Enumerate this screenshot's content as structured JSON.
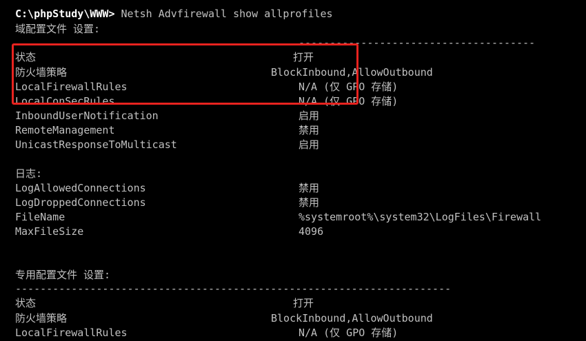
{
  "terminal": {
    "prompt": "C:\\phpStudy\\WWW>",
    "command": " Netsh Advfirewall show allprofiles",
    "domain_header": "域配置文件 设置:",
    "separator": "----------------------------------------------------------------------",
    "domain_rows": [
      {
        "key": "状态",
        "value": "打开"
      },
      {
        "key": "防火墙策略",
        "value": "BlockInbound,AllowOutbound"
      },
      {
        "key": "LocalFirewallRules",
        "value": "N/A (仅 GPO 存储)"
      },
      {
        "key": "LocalConSecRules",
        "value": "N/A (仅 GPO 存储)"
      },
      {
        "key": "InboundUserNotification",
        "value": "启用"
      },
      {
        "key": "RemoteManagement",
        "value": "禁用"
      },
      {
        "key": "UnicastResponseToMulticast",
        "value": "启用"
      }
    ],
    "log_header": "日志:",
    "log_rows": [
      {
        "key": "LogAllowedConnections",
        "value": "禁用"
      },
      {
        "key": "LogDroppedConnections",
        "value": "禁用"
      },
      {
        "key": "FileName",
        "value": "%systemroot%\\system32\\LogFiles\\Firewall"
      },
      {
        "key": "MaxFileSize",
        "value": "4096"
      }
    ],
    "private_header": "专用配置文件 设置:",
    "private_rows": [
      {
        "key": "状态",
        "value": "打开"
      },
      {
        "key": "防火墙策略",
        "value": "BlockInbound,AllowOutbound"
      },
      {
        "key": "LocalFirewallRules",
        "value": "N/A (仅 GPO 存储)"
      }
    ]
  },
  "colors": {
    "background": "#000000",
    "text": "#c0c0c0",
    "prompt": "#ffffff",
    "highlight_box": "#e8231f"
  }
}
